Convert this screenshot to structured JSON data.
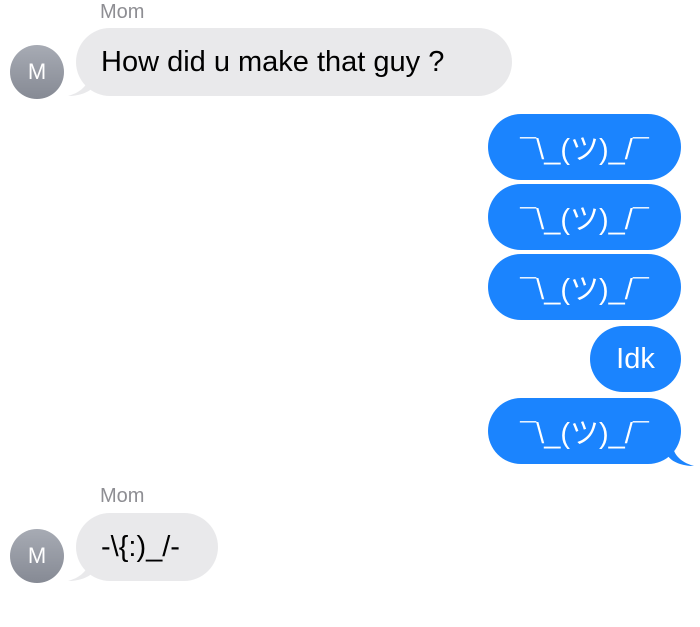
{
  "thread": {
    "contact_name": "Mom",
    "contact_initial": "M",
    "messages": [
      {
        "from": "contact",
        "text": "How did u make that guy ?"
      },
      {
        "from": "me",
        "text": "¯\\_(ツ)_/¯"
      },
      {
        "from": "me",
        "text": "¯\\_(ツ)_/¯"
      },
      {
        "from": "me",
        "text": "¯\\_(ツ)_/¯"
      },
      {
        "from": "me",
        "text": "Idk"
      },
      {
        "from": "me",
        "text": "¯\\_(ツ)_/¯"
      },
      {
        "from": "contact",
        "text": "-\\{:)_/-"
      }
    ]
  },
  "colors": {
    "incoming_bubble": "#e9e9eb",
    "outgoing_bubble": "#1b84fe",
    "sender_name": "#8e8e93"
  }
}
